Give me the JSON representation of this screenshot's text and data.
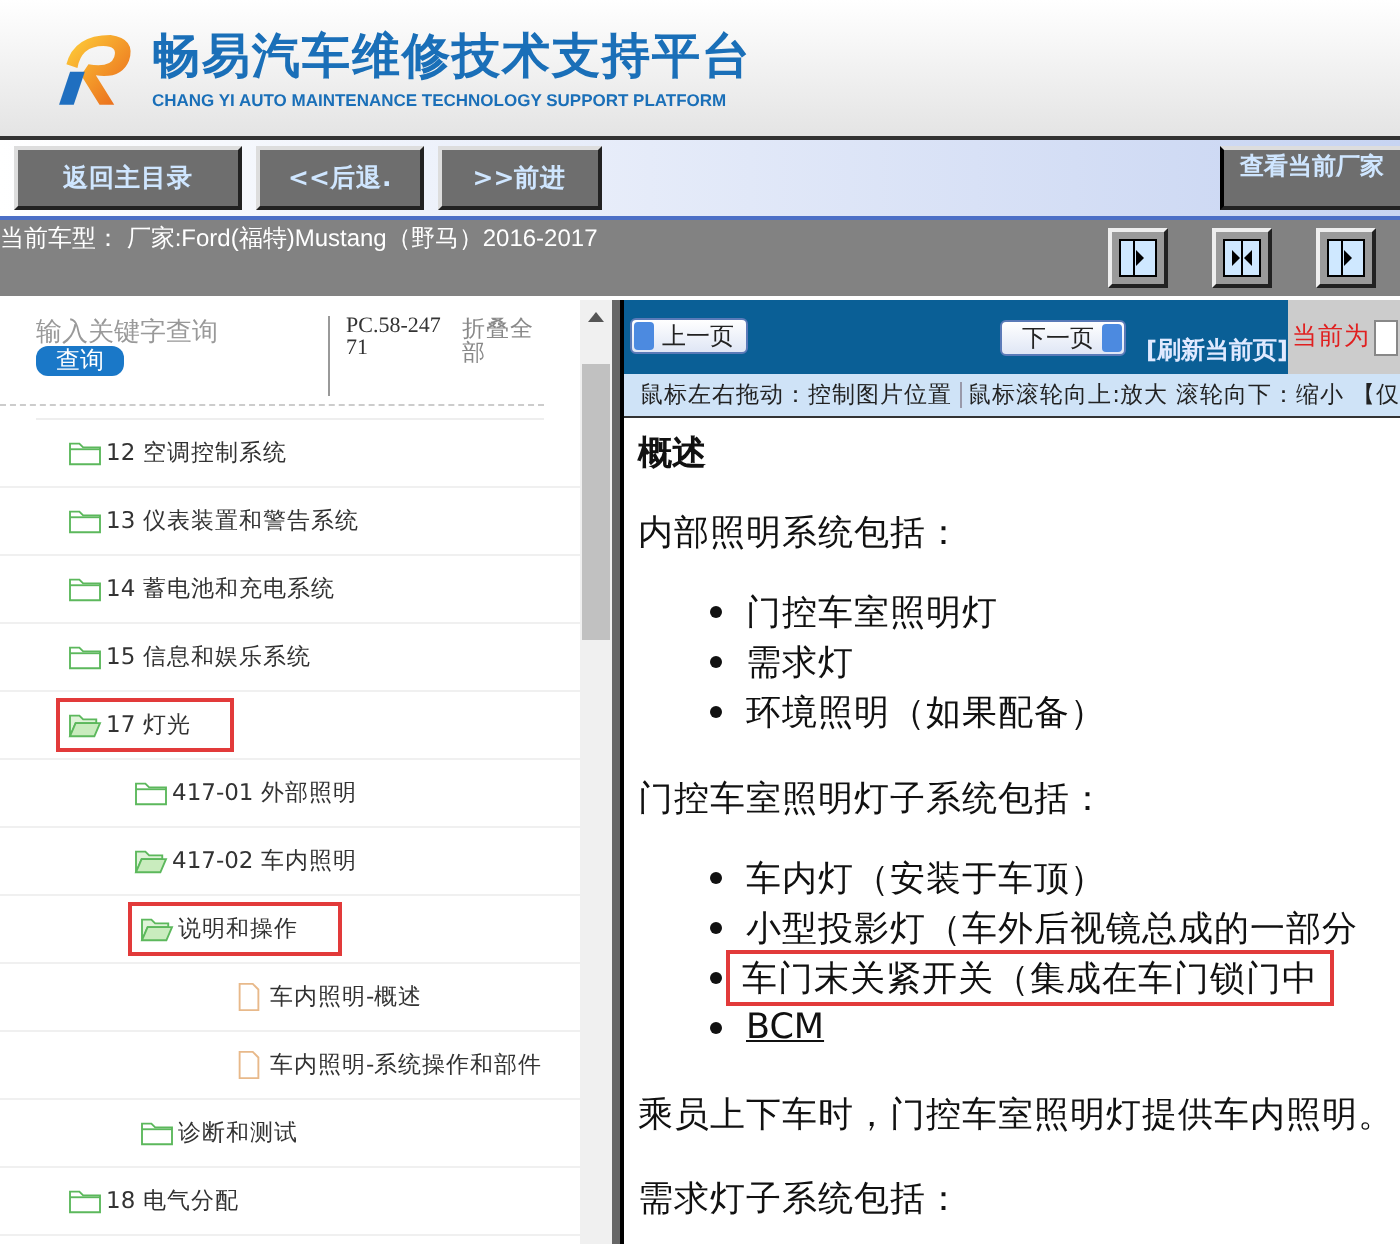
{
  "header": {
    "title": "畅易汽车维修技术支持平台",
    "subtitle": "CHANG YI AUTO MAINTENANCE TECHNOLOGY SUPPORT PLATFORM"
  },
  "toolbar": {
    "buttons": [
      "返回主目录",
      "<<后退.",
      ">>前进"
    ],
    "right_button": "查看当前厂家"
  },
  "model_bar": {
    "text": "当前车型： 厂家:Ford(福特)Mustang（野马）2016-2017",
    "view_buttons": [
      {
        "kind": "single"
      },
      {
        "kind": "split"
      },
      {
        "kind": "single"
      }
    ]
  },
  "search": {
    "placeholder": "输入关键字查询",
    "button": "查询",
    "code": "PC.58-24771",
    "collapse": "折叠全部"
  },
  "tree": [
    {
      "label": "12 空调控制系统",
      "kind": "folder",
      "expanded": false,
      "highlighted": false
    },
    {
      "label": "13 仪表装置和警告系统",
      "kind": "folder",
      "expanded": false,
      "highlighted": false
    },
    {
      "label": "14 蓄电池和充电系统",
      "kind": "folder",
      "expanded": false,
      "highlighted": false
    },
    {
      "label": "15 信息和娱乐系统",
      "kind": "folder",
      "expanded": false,
      "highlighted": false
    },
    {
      "label": "17 灯光",
      "kind": "folder",
      "expanded": true,
      "highlighted": true,
      "children": [
        {
          "label": "417-01 外部照明",
          "kind": "folder",
          "expanded": false,
          "highlighted": false
        },
        {
          "label": "417-02 车内照明",
          "kind": "folder",
          "expanded": true,
          "highlighted": false,
          "children": [
            {
              "label": "说明和操作",
              "kind": "folder",
              "expanded": true,
              "highlighted": true,
              "children": [
                {
                  "label": "车内照明-概述",
                  "kind": "doc",
                  "highlighted": false
                },
                {
                  "label": "车内照明-系统操作和部件",
                  "kind": "doc",
                  "highlighted": false
                }
              ]
            },
            {
              "label": "诊断和测试",
              "kind": "folder",
              "expanded": false,
              "highlighted": false
            }
          ]
        }
      ]
    },
    {
      "label": "18 电气分配",
      "kind": "folder",
      "expanded": false,
      "highlighted": false
    }
  ],
  "pager": {
    "prev": "上一页",
    "next": "下一页",
    "refresh": "[刷新当前页]",
    "current_label": "当前为"
  },
  "hint_bar": [
    "鼠标左右拖动：控制图片位置",
    "鼠标滚轮向上:放大",
    "滚轮向下：缩小",
    "【仅"
  ],
  "document": [
    {
      "kind": "heading",
      "text": "概述"
    },
    {
      "kind": "paragraph",
      "text": "内部照明系统包括："
    },
    {
      "kind": "list",
      "items": [
        {
          "text": "门控车室照明灯",
          "highlighted": false
        },
        {
          "text": "需求灯",
          "highlighted": false
        },
        {
          "text": "环境照明（如果配备）",
          "highlighted": false
        }
      ]
    },
    {
      "kind": "paragraph",
      "text": "门控车室照明灯子系统包括："
    },
    {
      "kind": "list",
      "items": [
        {
          "text": "车内灯（安装于车顶）",
          "highlighted": false
        },
        {
          "text": "小型投影灯（车外后视镜总成的一部分",
          "highlighted": false
        },
        {
          "text": "车门末关紧开关（集成在车门锁门中",
          "highlighted": true
        },
        {
          "text": "BCM",
          "highlighted": false,
          "link": true
        }
      ]
    },
    {
      "kind": "paragraph",
      "text": "乘员上下车时，门控车室照明灯提供车内照明。"
    },
    {
      "kind": "paragraph",
      "text": "需求灯子系统包括："
    }
  ]
}
